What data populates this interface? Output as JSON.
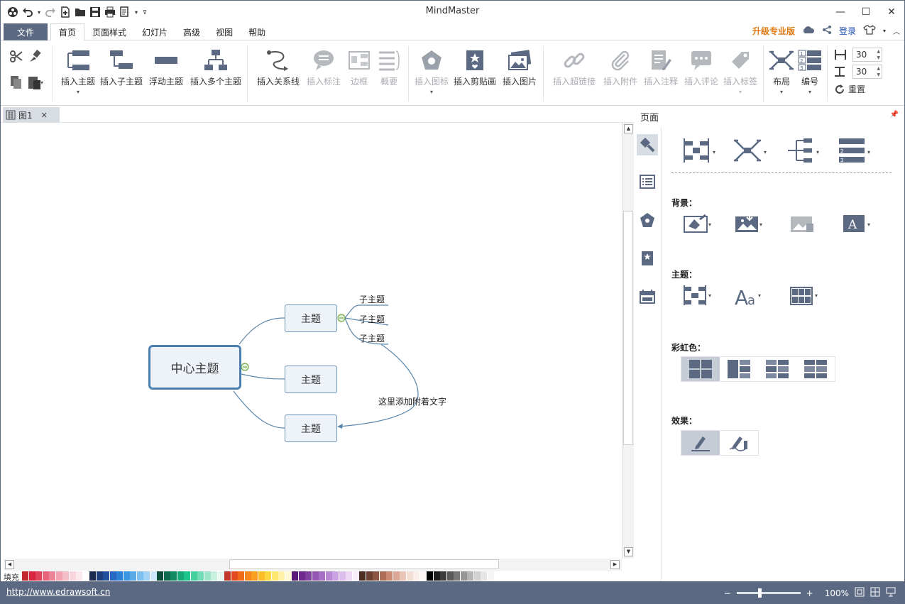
{
  "app": {
    "title": "MindMaster",
    "upgrade_label": "升级专业版",
    "login_label": "登录"
  },
  "menu": {
    "file_label": "文件",
    "tabs": [
      "首页",
      "页面样式",
      "幻灯片",
      "高级",
      "视图",
      "帮助"
    ],
    "active_tab": "首页"
  },
  "ribbon": {
    "insert_topic": "插入主题",
    "insert_subtopic": "插入子主题",
    "floating_topic": "浮动主题",
    "insert_multiple": "插入多个主题",
    "insert_relationship": "插入关系线",
    "insert_callout": "插入标注",
    "boundary": "边框",
    "summary": "概要",
    "insert_icon": "插入图标",
    "insert_clipart": "插入剪贴画",
    "insert_image": "插入图片",
    "insert_hyperlink": "插入超链接",
    "insert_attachment": "插入附件",
    "insert_note": "插入注释",
    "insert_comment": "插入评论",
    "insert_tag": "插入标签",
    "layout": "布局",
    "numbering": "编号",
    "spacing_h": "30",
    "spacing_v": "30",
    "reset": "重置"
  },
  "doc_tab": {
    "name": "图1"
  },
  "mindmap": {
    "central": "中心主题",
    "topics": [
      "主题",
      "主题",
      "主题"
    ],
    "subtopics": [
      "子主题",
      "子主题",
      "子主题"
    ],
    "relationship_text": "这里添加附着文字"
  },
  "side_panel": {
    "title": "页面",
    "background_label": "背景：",
    "theme_label": "主题：",
    "rainbow_label": "彩虹色：",
    "effect_label": "效果："
  },
  "colorbar": {
    "fill_label": "填充",
    "swatches": [
      "#c1272d",
      "#d7263d",
      "#e0445a",
      "#e5667a",
      "#ea8496",
      "#f0a2b1",
      "#f4bdc8",
      "#f9d6de",
      "#fce9ee",
      "#ffffff",
      "#1b2a4e",
      "#1f3c7a",
      "#22509e",
      "#2668c2",
      "#2d7fd6",
      "#3b95e0",
      "#5aaae8",
      "#7dbfee",
      "#a3d3f4",
      "#cde6f9",
      "#0b4d3a",
      "#0e6b4d",
      "#128a62",
      "#16a876",
      "#1bc58b",
      "#46d09f",
      "#72dab4",
      "#9ee4c9",
      "#c9efde",
      "#e6f8f0",
      "#c0392b",
      "#e14b1f",
      "#f06a1a",
      "#f5851d",
      "#f9a11e",
      "#fbbd24",
      "#fdd740",
      "#fee771",
      "#fff2a8",
      "#fff9d6",
      "#5b1a7a",
      "#6d2a8c",
      "#80409f",
      "#9357b2",
      "#a66fc4",
      "#b988d4",
      "#cba2e1",
      "#dcbdeb",
      "#ecd8f4",
      "#f6ecfa",
      "#4a2c20",
      "#6b4030",
      "#8c5642",
      "#ad6e57",
      "#c98a73",
      "#dba897",
      "#e9c5b8",
      "#f3ded5",
      "#f9eee9",
      "#fdf8f5",
      "#000000",
      "#1e1e1e",
      "#3c3c3c",
      "#5a5a5a",
      "#787878",
      "#969696",
      "#b4b4b4",
      "#d2d2d2",
      "#e6e6e6",
      "#f5f5f5"
    ]
  },
  "status": {
    "url": "http://www.edrawsoft.cn",
    "zoom": "100%"
  }
}
